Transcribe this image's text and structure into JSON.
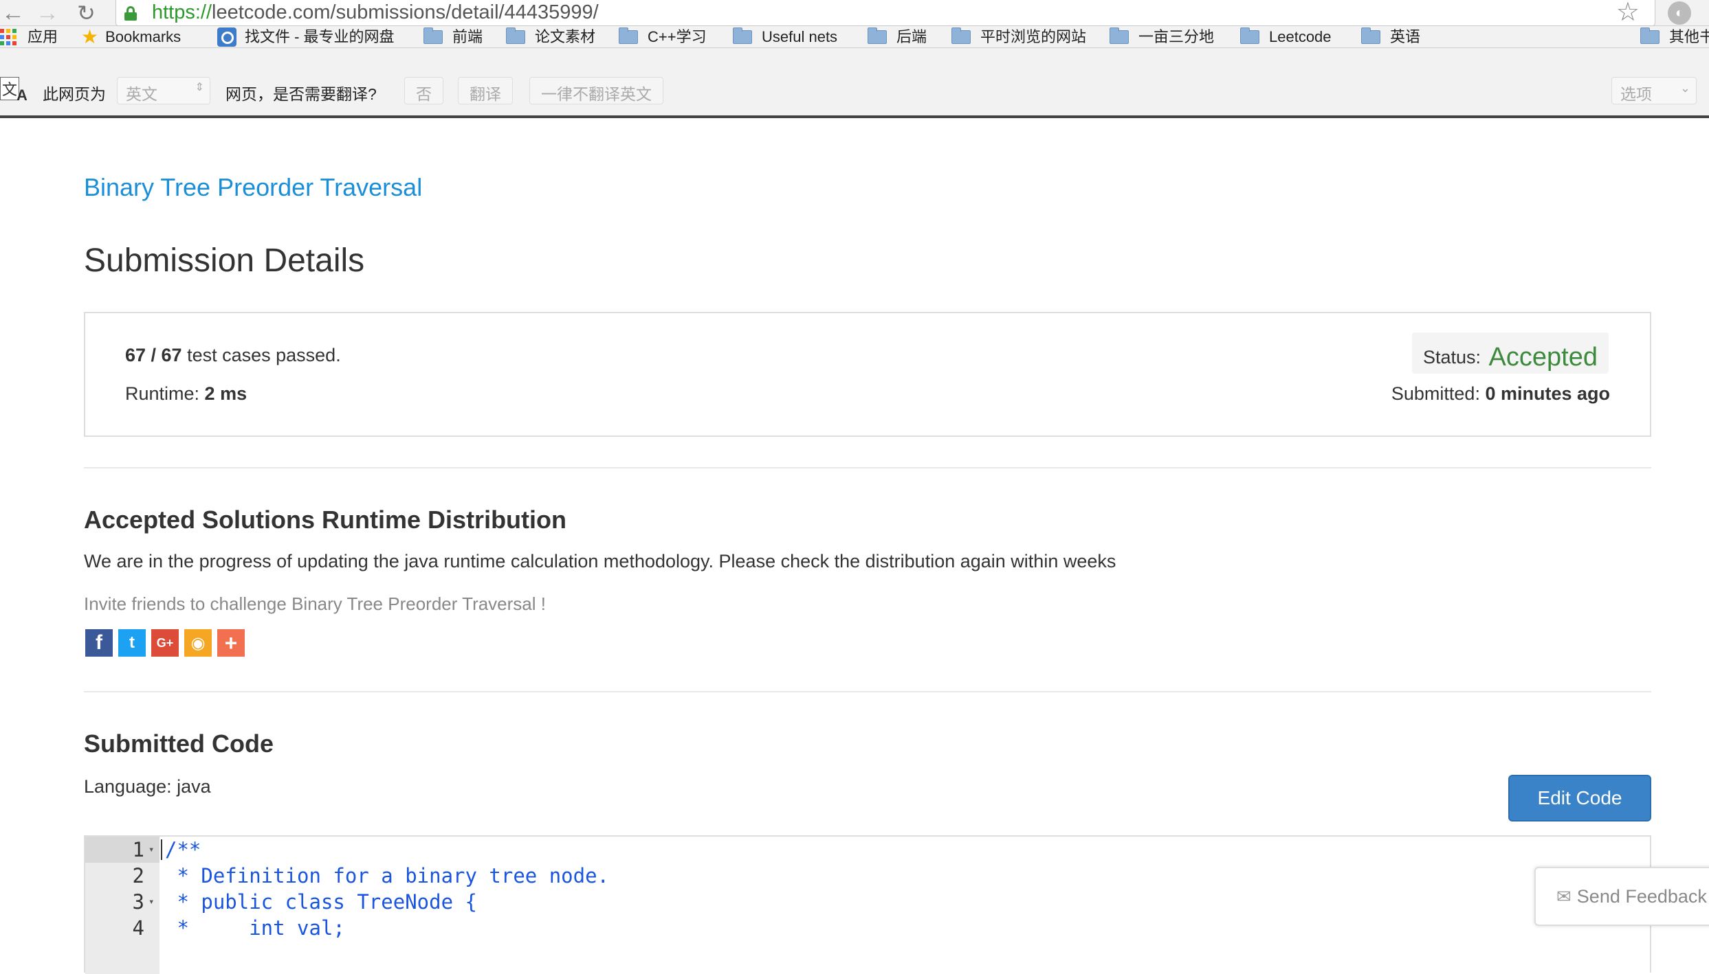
{
  "browser": {
    "url_scheme": "https://",
    "url_rest": "leetcode.com/submissions/detail/44435999/",
    "bookmarks": [
      "应用",
      "Bookmarks",
      "找文件 - 最专业的网盘",
      "前端",
      "论文素材",
      "C++学习",
      "Useful nets",
      "后端",
      "平时浏览的网站",
      "一亩三分地",
      "Leetcode",
      "英语",
      "其他书签"
    ],
    "translate": {
      "page_is": "此网页为",
      "language": "英文",
      "question": "网页，是否需要翻译?",
      "no": "否",
      "translate": "翻译",
      "never": "一律不翻译英文",
      "options": "选项"
    }
  },
  "page": {
    "problem_title": "Binary Tree Preorder Traversal",
    "heading": "Submission Details",
    "result": {
      "passed_count": "67 / 67",
      "passed_suffix": " test cases passed.",
      "runtime_label": "Runtime: ",
      "runtime_value": "2 ms",
      "status_label": "Status: ",
      "status_value": "Accepted",
      "submitted_label": "Submitted: ",
      "submitted_value": "0 minutes ago"
    },
    "distribution": {
      "title": "Accepted Solutions Runtime Distribution",
      "note": "We are in the progress of updating the java runtime calculation methodology. Please check the distribution again within weeks",
      "invite": "Invite friends to challenge Binary Tree Preorder Traversal !"
    },
    "share": [
      {
        "name": "facebook-share-icon",
        "glyph": "f"
      },
      {
        "name": "twitter-share-icon",
        "glyph": "t"
      },
      {
        "name": "google-plus-share-icon",
        "glyph": "G+"
      },
      {
        "name": "weibo-share-icon",
        "glyph": "◉"
      },
      {
        "name": "more-share-icon",
        "glyph": "+"
      }
    ],
    "code": {
      "title": "Submitted Code",
      "language_label": "Language: ",
      "language": "java",
      "edit_button": "Edit Code",
      "lines": [
        {
          "num": "1",
          "text": "/**"
        },
        {
          "num": "2",
          "text": " * Definition for a binary tree node."
        },
        {
          "num": "3",
          "text": " * public class TreeNode {"
        },
        {
          "num": "4",
          "text": " *     int val;"
        }
      ]
    },
    "feedback": "Send Feedback"
  },
  "colors": {
    "link": "#1a8fd8",
    "accepted": "#3c8a3c",
    "primary_button": "#3a83c9",
    "code_comment": "#1a55e0"
  }
}
